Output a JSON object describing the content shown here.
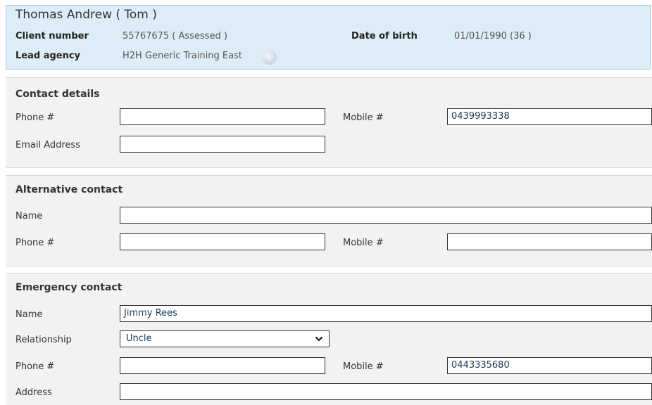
{
  "client": {
    "name": "Thomas Andrew ( Tom )",
    "client_number_label": "Client number",
    "client_number_value": "55767675 ( Assessed )",
    "lead_agency_label": "Lead agency",
    "lead_agency_value": "H2H Generic Training East",
    "dob_label": "Date of birth",
    "dob_value": "01/01/1990 (36 )",
    "info_icon": "i"
  },
  "contact_details": {
    "title": "Contact details",
    "phone_label": "Phone #",
    "phone_value": "",
    "mobile_label": "Mobile #",
    "mobile_value": "0439993338",
    "email_label": "Email Address",
    "email_value": ""
  },
  "alternative_contact": {
    "title": "Alternative contact",
    "name_label": "Name",
    "name_value": "",
    "phone_label": "Phone #",
    "phone_value": "",
    "mobile_label": "Mobile #",
    "mobile_value": ""
  },
  "emergency_contact": {
    "title": "Emergency contact",
    "name_label": "Name",
    "name_value": "Jimmy Rees",
    "relationship_label": "Relationship",
    "relationship_value": "Uncle",
    "phone_label": "Phone #",
    "phone_value": "",
    "mobile_label": "Mobile #",
    "mobile_value": "0443335680",
    "address_label": "Address",
    "address_value": ""
  }
}
